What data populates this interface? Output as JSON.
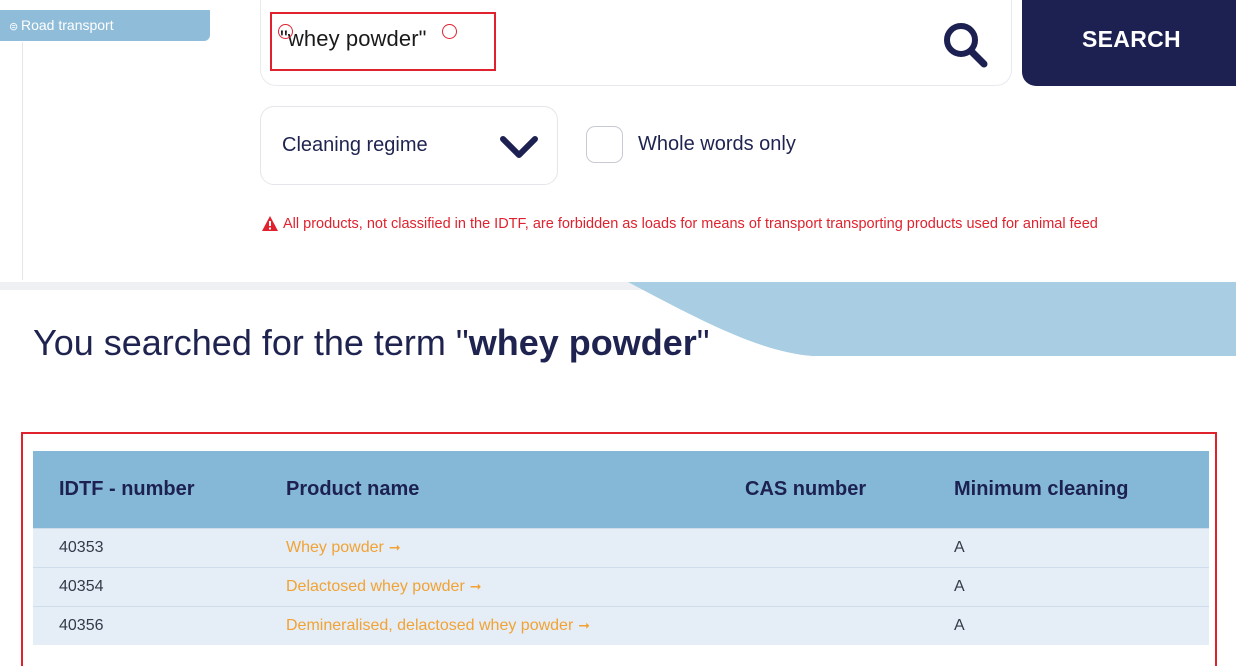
{
  "sidebar": {
    "active_tab_label": "Road transport"
  },
  "search": {
    "value": "\"whey powder\"",
    "button_label": "SEARCH"
  },
  "filters": {
    "regime_label": "Cleaning regime",
    "whole_words_label": "Whole words only",
    "whole_words_checked": false
  },
  "warning": {
    "text": "All products, not classified in the IDTF, are forbidden as loads for means of transport transporting products used for animal feed"
  },
  "results": {
    "heading_prefix": "You searched for the term \"",
    "term": "whey powder",
    "heading_suffix": "\"",
    "columns": [
      "IDTF - number",
      "Product name",
      "CAS number",
      "Minimum cleaning"
    ],
    "rows": [
      {
        "number": "40353",
        "name": "Whey powder",
        "cas": "",
        "cleaning": "A"
      },
      {
        "number": "40354",
        "name": "Delactosed whey powder",
        "cas": "",
        "cleaning": "A"
      },
      {
        "number": "40356",
        "name": "Demineralised, delactosed whey powder",
        "cas": "",
        "cleaning": "A"
      }
    ]
  },
  "icons": {
    "search": "search-icon",
    "chevron": "chevron-down-icon",
    "warning": "warning-icon",
    "arrow": "arrow-right-icon"
  },
  "colors": {
    "navy": "#1c2151",
    "light_blue": "#85b8d7",
    "row_bg": "#e5eef7",
    "link_orange": "#f2a233",
    "warning_red": "#e0222e"
  }
}
